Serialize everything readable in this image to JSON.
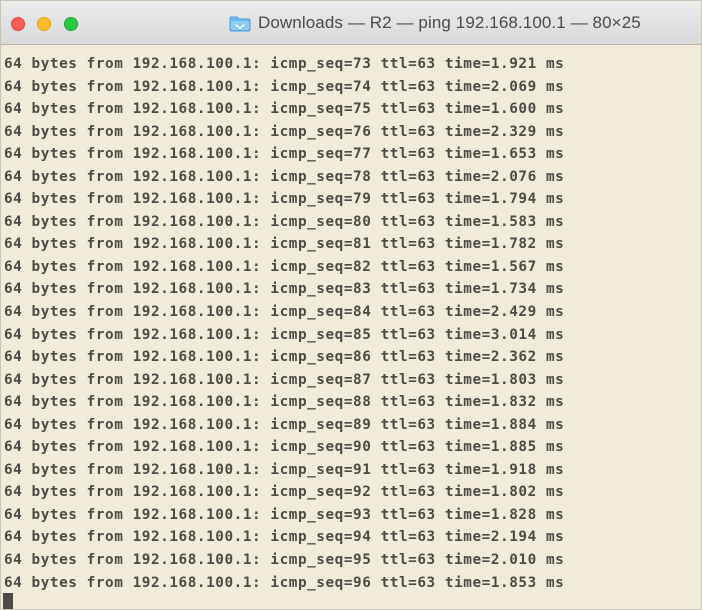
{
  "window": {
    "title": "Downloads — R2 — ping 192.168.100.1 — 80×25",
    "folder_icon": "folder-icon",
    "terminal_background": "#f0ecd9",
    "terminal_text_color": "#4c4a45"
  },
  "terminal": {
    "lines": [
      "64 bytes from 192.168.100.1: icmp_seq=73 ttl=63 time=1.921 ms",
      "64 bytes from 192.168.100.1: icmp_seq=74 ttl=63 time=2.069 ms",
      "64 bytes from 192.168.100.1: icmp_seq=75 ttl=63 time=1.600 ms",
      "64 bytes from 192.168.100.1: icmp_seq=76 ttl=63 time=2.329 ms",
      "64 bytes from 192.168.100.1: icmp_seq=77 ttl=63 time=1.653 ms",
      "64 bytes from 192.168.100.1: icmp_seq=78 ttl=63 time=2.076 ms",
      "64 bytes from 192.168.100.1: icmp_seq=79 ttl=63 time=1.794 ms",
      "64 bytes from 192.168.100.1: icmp_seq=80 ttl=63 time=1.583 ms",
      "64 bytes from 192.168.100.1: icmp_seq=81 ttl=63 time=1.782 ms",
      "64 bytes from 192.168.100.1: icmp_seq=82 ttl=63 time=1.567 ms",
      "64 bytes from 192.168.100.1: icmp_seq=83 ttl=63 time=1.734 ms",
      "64 bytes from 192.168.100.1: icmp_seq=84 ttl=63 time=2.429 ms",
      "64 bytes from 192.168.100.1: icmp_seq=85 ttl=63 time=3.014 ms",
      "64 bytes from 192.168.100.1: icmp_seq=86 ttl=63 time=2.362 ms",
      "64 bytes from 192.168.100.1: icmp_seq=87 ttl=63 time=1.803 ms",
      "64 bytes from 192.168.100.1: icmp_seq=88 ttl=63 time=1.832 ms",
      "64 bytes from 192.168.100.1: icmp_seq=89 ttl=63 time=1.884 ms",
      "64 bytes from 192.168.100.1: icmp_seq=90 ttl=63 time=1.885 ms",
      "64 bytes from 192.168.100.1: icmp_seq=91 ttl=63 time=1.918 ms",
      "64 bytes from 192.168.100.1: icmp_seq=92 ttl=63 time=1.802 ms",
      "64 bytes from 192.168.100.1: icmp_seq=93 ttl=63 time=1.828 ms",
      "64 bytes from 192.168.100.1: icmp_seq=94 ttl=63 time=2.194 ms",
      "64 bytes from 192.168.100.1: icmp_seq=95 ttl=63 time=2.010 ms",
      "64 bytes from 192.168.100.1: icmp_seq=96 ttl=63 time=1.853 ms"
    ]
  }
}
